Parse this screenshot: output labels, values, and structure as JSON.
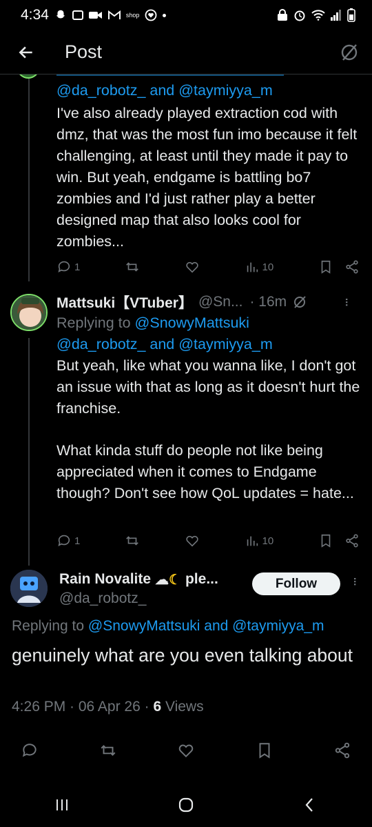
{
  "status_bar": {
    "time": "4:34",
    "notif_text": "shop"
  },
  "header": {
    "title": "Post"
  },
  "reply1": {
    "mentions": "@da_robotz_ and @taymiyya_m",
    "text": "I've also already played extraction cod with dmz, that was the most fun imo because it felt challenging, at least until they made it pay to win. But yeah, endgame is battling bo7 zombies and I'd just rather play a better designed map that also looks cool for zombies...",
    "replies": "1",
    "views": "10"
  },
  "reply2": {
    "name": "Mattsuki【VTuber】",
    "handle": "@Sn...",
    "time": "· 16m",
    "replying_prefix": "Replying to ",
    "replying_user": "@SnowyMattsuki",
    "mentions": "@da_robotz_ and @taymiyya_m",
    "text_p1": "But yeah, like what you wanna like, I don't got an issue with that as long as it doesn't hurt the franchise.",
    "text_p2": "What kinda stuff do people not like being appreciated when it comes to Endgame though? Don't see how QoL updates = hate...",
    "replies": "1",
    "views": "10"
  },
  "main_post": {
    "name": "Rain Novalite",
    "name_suffix": "ple...",
    "handle": "@da_robotz_",
    "follow_label": "Follow",
    "replying_prefix": "Replying to ",
    "replying_users": "@SnowyMattsuki and @taymiyya_m",
    "text": "genuinely what are you even talking about",
    "timestamp": "4:26 PM · 06 Apr 26 · ",
    "views_count": "6",
    "views_label": " Views"
  },
  "colors": {
    "accent": "#1d9bf0",
    "muted": "#71767b",
    "text": "#e7e9ea",
    "background": "#000000"
  }
}
